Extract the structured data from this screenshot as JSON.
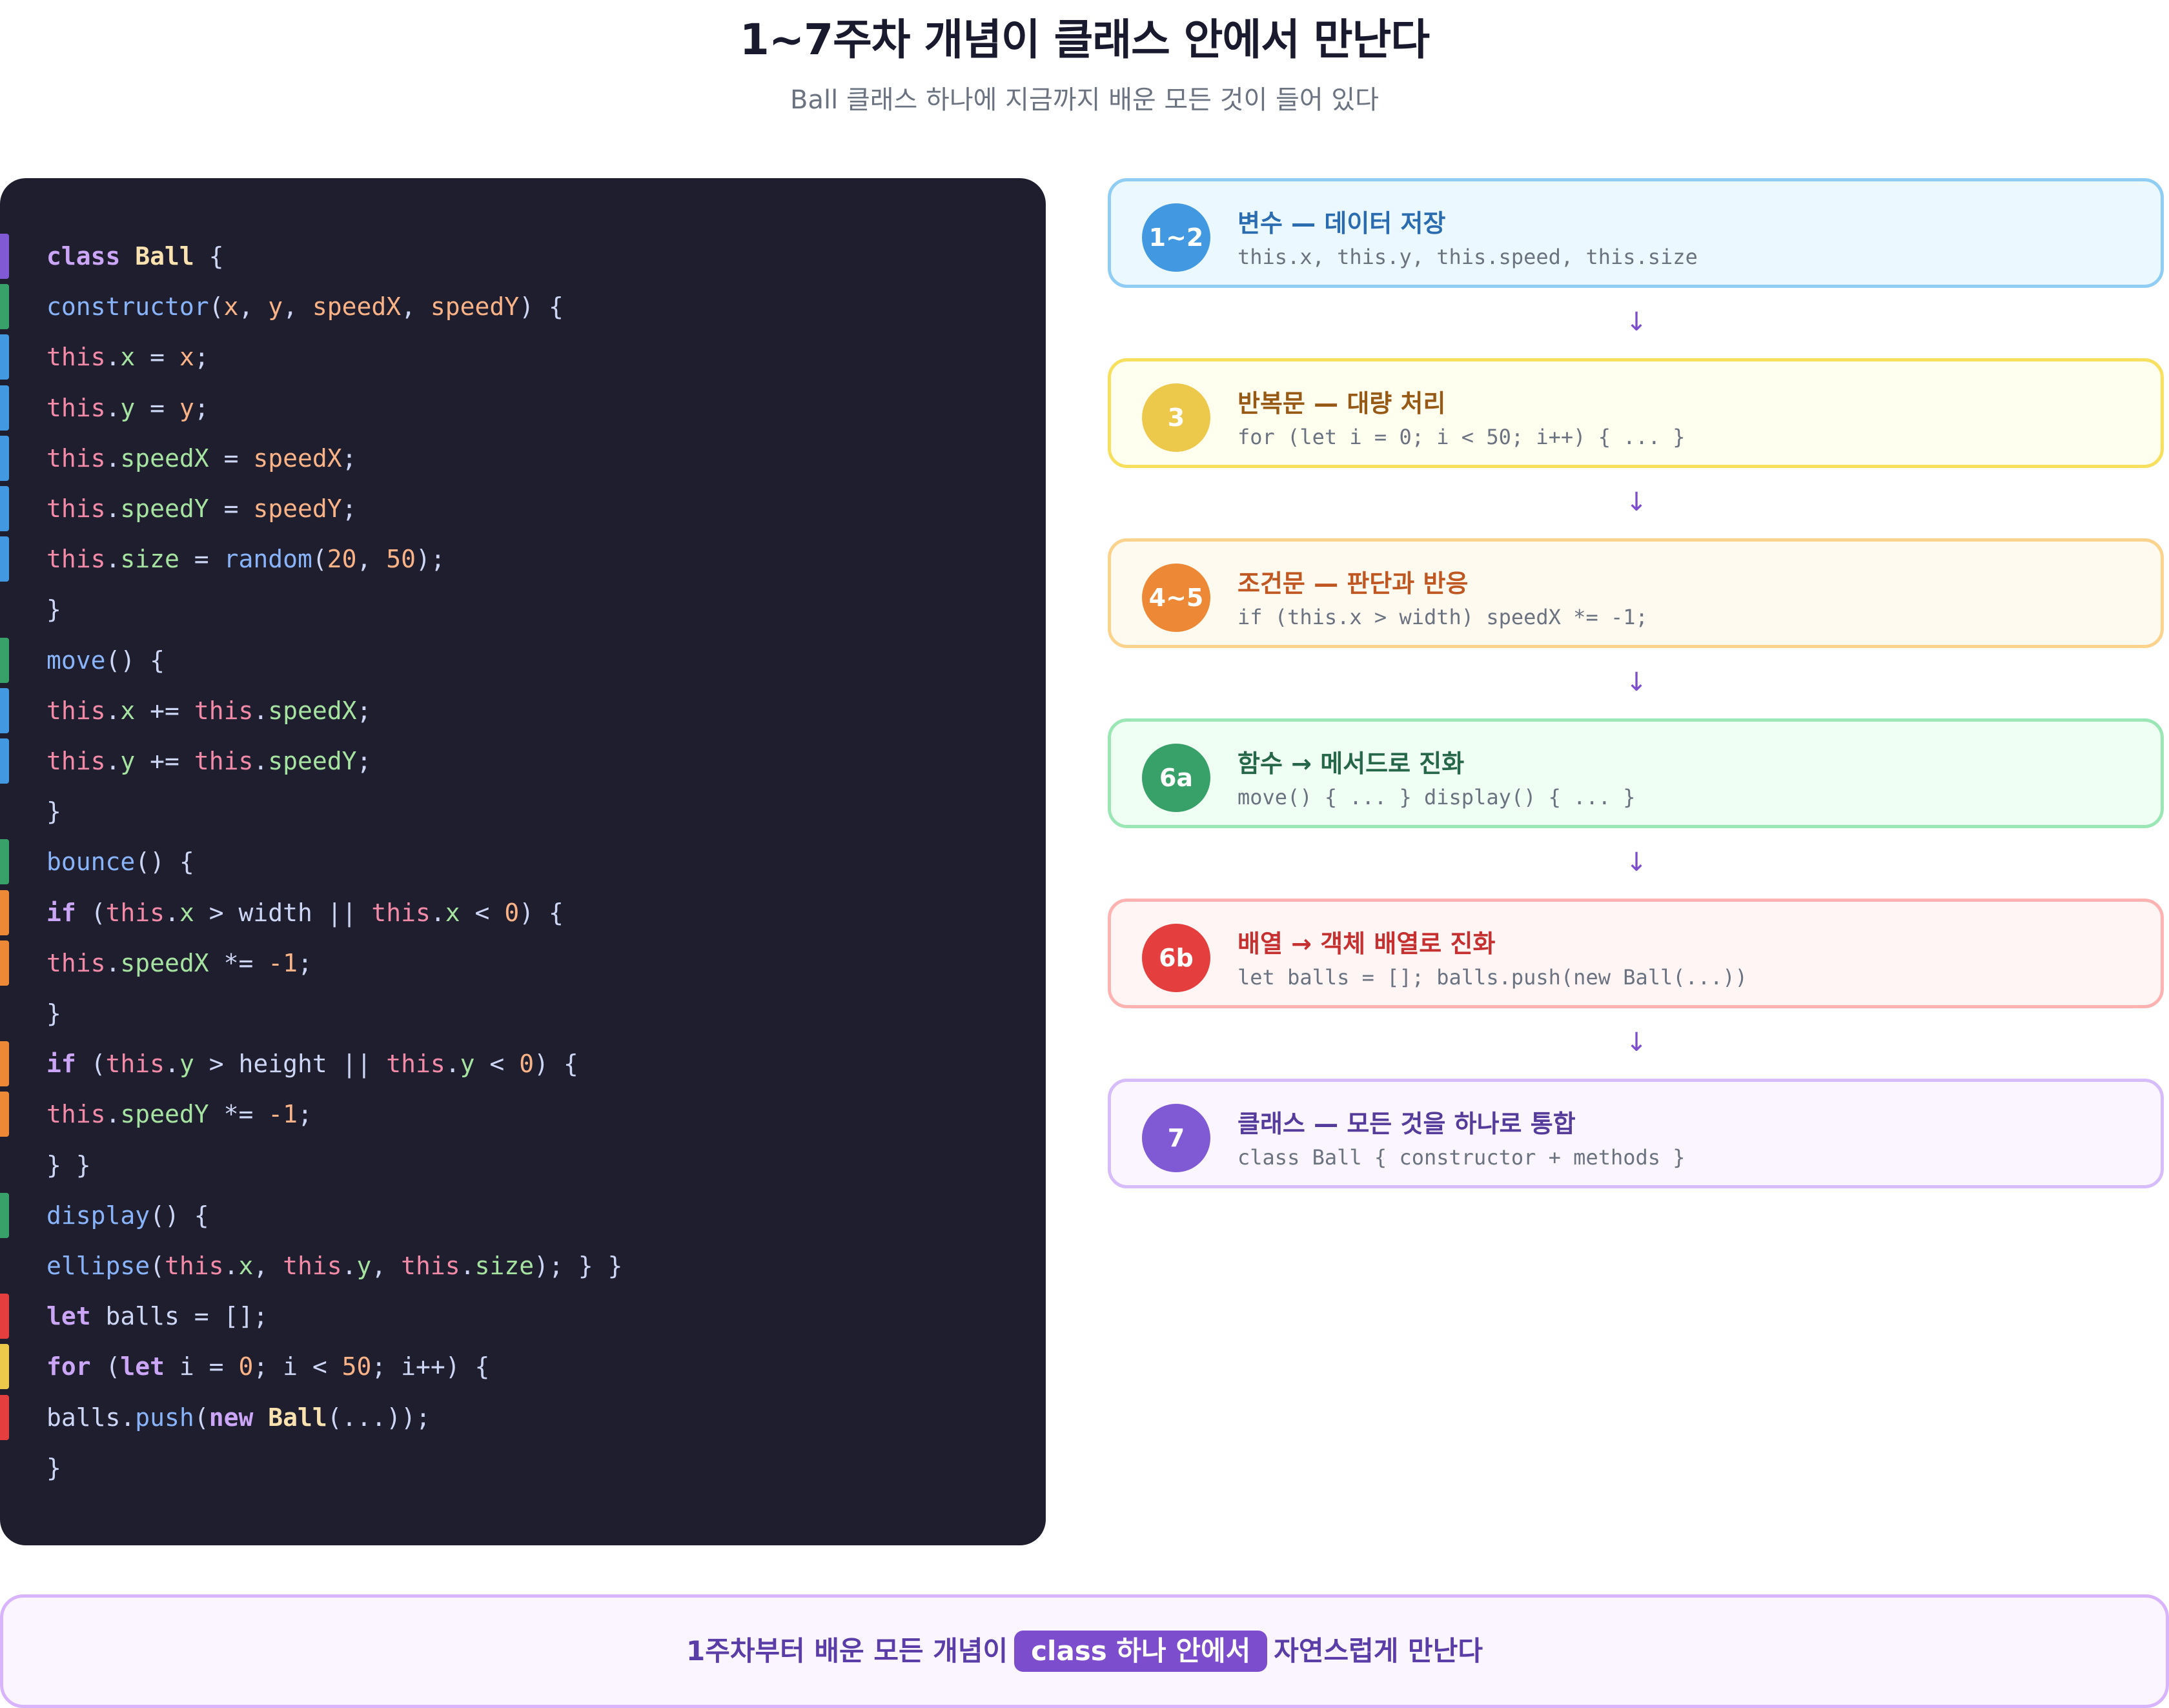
{
  "header": {
    "title": "1~7주차 개념이 클래스 안에서 만난다",
    "subtitle": "Ball 클래스 하나에 지금까지 배운 모든 것이 들어 있다"
  },
  "colors": {
    "variable": "#4299e1",
    "loop": "#ecc94b",
    "condition": "#ed8936",
    "function": "#38a169",
    "array": "#e53e3e",
    "class": "#805ad5"
  },
  "code": {
    "lines": [
      {
        "bar": "#805ad5",
        "segments": [
          {
            "t": "class",
            "c": "kw"
          },
          {
            "t": " "
          },
          {
            "t": "Ball",
            "c": "cls"
          },
          {
            "t": " {"
          }
        ]
      },
      {
        "bar": "#38a169",
        "segments": [
          {
            "t": "constructor",
            "c": "fn"
          },
          {
            "t": "("
          },
          {
            "t": "x",
            "c": "par"
          },
          {
            "t": ", "
          },
          {
            "t": "y",
            "c": "par"
          },
          {
            "t": ", "
          },
          {
            "t": "speedX",
            "c": "par"
          },
          {
            "t": ", "
          },
          {
            "t": "speedY",
            "c": "par"
          },
          {
            "t": ") {"
          }
        ]
      },
      {
        "bar": "#4299e1",
        "segments": [
          {
            "t": "this",
            "c": "ths"
          },
          {
            "t": "."
          },
          {
            "t": "x",
            "c": "prop"
          },
          {
            "t": " = "
          },
          {
            "t": "x",
            "c": "par"
          },
          {
            "t": ";"
          }
        ]
      },
      {
        "bar": "#4299e1",
        "segments": [
          {
            "t": "this",
            "c": "ths"
          },
          {
            "t": "."
          },
          {
            "t": "y",
            "c": "prop"
          },
          {
            "t": " = "
          },
          {
            "t": "y",
            "c": "par"
          },
          {
            "t": ";"
          }
        ]
      },
      {
        "bar": "#4299e1",
        "segments": [
          {
            "t": "this",
            "c": "ths"
          },
          {
            "t": "."
          },
          {
            "t": "speedX",
            "c": "prop"
          },
          {
            "t": " = "
          },
          {
            "t": "speedX",
            "c": "par"
          },
          {
            "t": ";"
          }
        ]
      },
      {
        "bar": "#4299e1",
        "segments": [
          {
            "t": "this",
            "c": "ths"
          },
          {
            "t": "."
          },
          {
            "t": "speedY",
            "c": "prop"
          },
          {
            "t": " = "
          },
          {
            "t": "speedY",
            "c": "par"
          },
          {
            "t": ";"
          }
        ]
      },
      {
        "bar": "#4299e1",
        "segments": [
          {
            "t": "this",
            "c": "ths"
          },
          {
            "t": "."
          },
          {
            "t": "size",
            "c": "prop"
          },
          {
            "t": " = "
          },
          {
            "t": "random",
            "c": "fn"
          },
          {
            "t": "("
          },
          {
            "t": "20",
            "c": "num"
          },
          {
            "t": ", "
          },
          {
            "t": "50",
            "c": "num"
          },
          {
            "t": ");"
          }
        ]
      },
      {
        "bar": "",
        "segments": [
          {
            "t": "}"
          }
        ]
      },
      {
        "bar": "#38a169",
        "segments": [
          {
            "t": "move",
            "c": "fn"
          },
          {
            "t": "() {"
          }
        ]
      },
      {
        "bar": "#4299e1",
        "segments": [
          {
            "t": "this",
            "c": "ths"
          },
          {
            "t": "."
          },
          {
            "t": "x",
            "c": "prop"
          },
          {
            "t": " += "
          },
          {
            "t": "this",
            "c": "ths"
          },
          {
            "t": "."
          },
          {
            "t": "speedX",
            "c": "prop"
          },
          {
            "t": ";"
          }
        ]
      },
      {
        "bar": "#4299e1",
        "segments": [
          {
            "t": "this",
            "c": "ths"
          },
          {
            "t": "."
          },
          {
            "t": "y",
            "c": "prop"
          },
          {
            "t": " += "
          },
          {
            "t": "this",
            "c": "ths"
          },
          {
            "t": "."
          },
          {
            "t": "speedY",
            "c": "prop"
          },
          {
            "t": ";"
          }
        ]
      },
      {
        "bar": "",
        "segments": [
          {
            "t": "}"
          }
        ]
      },
      {
        "bar": "#38a169",
        "segments": [
          {
            "t": "bounce",
            "c": "fn"
          },
          {
            "t": "() {"
          }
        ]
      },
      {
        "bar": "#ed8936",
        "segments": [
          {
            "t": "if",
            "c": "kw"
          },
          {
            "t": " ("
          },
          {
            "t": "this",
            "c": "ths"
          },
          {
            "t": "."
          },
          {
            "t": "x",
            "c": "prop"
          },
          {
            "t": " > width || "
          },
          {
            "t": "this",
            "c": "ths"
          },
          {
            "t": "."
          },
          {
            "t": "x",
            "c": "prop"
          },
          {
            "t": " < "
          },
          {
            "t": "0",
            "c": "num"
          },
          {
            "t": ") {"
          }
        ]
      },
      {
        "bar": "#ed8936",
        "segments": [
          {
            "t": "this",
            "c": "ths"
          },
          {
            "t": "."
          },
          {
            "t": "speedX",
            "c": "prop"
          },
          {
            "t": " *= "
          },
          {
            "t": "-1",
            "c": "num"
          },
          {
            "t": ";"
          }
        ]
      },
      {
        "bar": "",
        "segments": [
          {
            "t": "}"
          }
        ]
      },
      {
        "bar": "#ed8936",
        "segments": [
          {
            "t": "if",
            "c": "kw"
          },
          {
            "t": " ("
          },
          {
            "t": "this",
            "c": "ths"
          },
          {
            "t": "."
          },
          {
            "t": "y",
            "c": "prop"
          },
          {
            "t": " > height || "
          },
          {
            "t": "this",
            "c": "ths"
          },
          {
            "t": "."
          },
          {
            "t": "y",
            "c": "prop"
          },
          {
            "t": " < "
          },
          {
            "t": "0",
            "c": "num"
          },
          {
            "t": ") {"
          }
        ]
      },
      {
        "bar": "#ed8936",
        "segments": [
          {
            "t": "this",
            "c": "ths"
          },
          {
            "t": "."
          },
          {
            "t": "speedY",
            "c": "prop"
          },
          {
            "t": " *= "
          },
          {
            "t": "-1",
            "c": "num"
          },
          {
            "t": ";"
          }
        ]
      },
      {
        "bar": "",
        "segments": [
          {
            "t": "} }"
          }
        ]
      },
      {
        "bar": "#38a169",
        "segments": [
          {
            "t": "display",
            "c": "fn"
          },
          {
            "t": "() {"
          }
        ]
      },
      {
        "bar": "",
        "segments": [
          {
            "t": "ellipse",
            "c": "fn"
          },
          {
            "t": "("
          },
          {
            "t": "this",
            "c": "ths"
          },
          {
            "t": "."
          },
          {
            "t": "x",
            "c": "prop"
          },
          {
            "t": ", "
          },
          {
            "t": "this",
            "c": "ths"
          },
          {
            "t": "."
          },
          {
            "t": "y",
            "c": "prop"
          },
          {
            "t": ", "
          },
          {
            "t": "this",
            "c": "ths"
          },
          {
            "t": "."
          },
          {
            "t": "size",
            "c": "prop"
          },
          {
            "t": "); } }"
          }
        ]
      },
      {
        "bar": "#e53e3e",
        "segments": [
          {
            "t": "let",
            "c": "kw"
          },
          {
            "t": " balls = [];"
          }
        ]
      },
      {
        "bar": "#ecc94b",
        "segments": [
          {
            "t": "for",
            "c": "kw"
          },
          {
            "t": " ("
          },
          {
            "t": "let",
            "c": "kw"
          },
          {
            "t": " i = "
          },
          {
            "t": "0",
            "c": "num"
          },
          {
            "t": "; i < "
          },
          {
            "t": "50",
            "c": "num"
          },
          {
            "t": "; i++) {"
          }
        ]
      },
      {
        "bar": "#e53e3e",
        "segments": [
          {
            "t": "balls."
          },
          {
            "t": "push",
            "c": "fn"
          },
          {
            "t": "("
          },
          {
            "t": "new",
            "c": "kw"
          },
          {
            "t": " "
          },
          {
            "t": "Ball",
            "c": "cls"
          },
          {
            "t": "(...));"
          }
        ]
      },
      {
        "bar": "",
        "segments": [
          {
            "t": "}"
          }
        ]
      }
    ]
  },
  "steps": [
    {
      "badge": "1~2",
      "title": "변수 — 데이터 저장",
      "code": "this.x, this.y, this.speed, this.size",
      "color": "#4299e1",
      "bg": "#ebf8ff",
      "border": "#90cdf4",
      "title_color": "#2b6cb0"
    },
    {
      "badge": "3",
      "title": "반복문 — 대량 처리",
      "code": "for (let i = 0; i < 50; i++) { ... }",
      "color": "#ecc94b",
      "bg": "#fffff0",
      "border": "#f6e05e",
      "title_color": "#975a16"
    },
    {
      "badge": "4~5",
      "title": "조건문 — 판단과 반응",
      "code": "if (this.x > width) speedX *= -1;",
      "color": "#ed8936",
      "bg": "#fffaf0",
      "border": "#fbd38d",
      "title_color": "#c05621"
    },
    {
      "badge": "6a",
      "title": "함수 → 메서드로 진화",
      "code": "move() { ... } display() { ... }",
      "color": "#38a169",
      "bg": "#f0fff4",
      "border": "#9ae6b4",
      "title_color": "#276749"
    },
    {
      "badge": "6b",
      "title": "배열 → 객체 배열로 진화",
      "code": "let balls = []; balls.push(new Ball(...))",
      "color": "#e53e3e",
      "bg": "#fff5f5",
      "border": "#feb2b2",
      "title_color": "#c53030"
    },
    {
      "badge": "7",
      "title": "클래스 — 모든 것을 하나로 통합",
      "code": "class Ball { constructor + methods }",
      "color": "#805ad5",
      "bg": "#faf5ff",
      "border": "#d6bcfa",
      "title_color": "#553c9a"
    }
  ],
  "arrow_glyph": "↓",
  "summary": {
    "before": "1주차부터 배운 모든 개념이",
    "highlight": "class 하나 안에서",
    "after": "자연스럽게 만난다"
  }
}
